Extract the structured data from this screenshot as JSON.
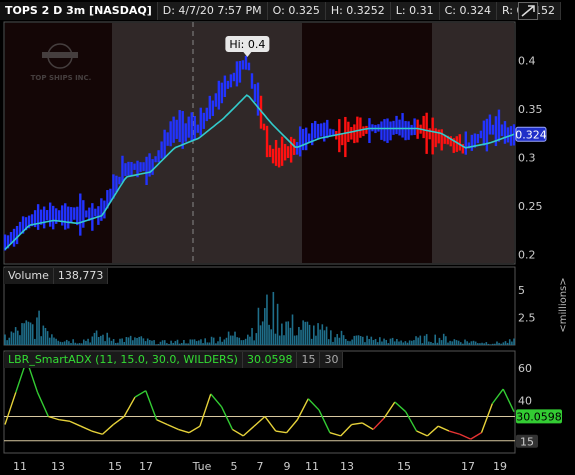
{
  "header": {
    "symbol": "TOPS 2 D 3m [NASDAQ]",
    "date": "D: 4/7/20 7:57 PM",
    "open": "O: 0.325",
    "high": "H: 0.3252",
    "low": "L: 0.31",
    "close": "C: 0.324",
    "range": "R: 0.0152"
  },
  "watermark": {
    "text": "TOP SHIPS INC."
  },
  "price_pane": {
    "hi_label": "Hi: 0.4",
    "last_price": "0.324",
    "y_ticks": [
      "0.4",
      "0.35",
      "0.3",
      "0.25",
      "0.2"
    ]
  },
  "volume_pane": {
    "label": "Volume",
    "value": "138,773",
    "y_ticks": [
      "5",
      "2.5"
    ],
    "unit": "<millions>"
  },
  "adx_pane": {
    "label": "LBR_SmartADX (11, 15.0, 30.0, WILDERS)",
    "value": "30.0598",
    "level1": "15",
    "level2": "30",
    "y_ticks": [
      "60",
      "40",
      "30",
      "15"
    ],
    "current": "30.0598",
    "level_badge": "15"
  },
  "x_axis": {
    "labels": [
      "11",
      "13",
      "15",
      "17",
      "Tue",
      "5",
      "7",
      "9",
      "11",
      "13",
      "15",
      "17",
      "19"
    ]
  },
  "colors": {
    "up": "#2233ff",
    "down": "#ff1111",
    "ma": "#33cccc",
    "volume": "#1f6f8b",
    "adx_green": "#33cc33",
    "adx_yellow": "#e6d23a",
    "adx_red": "#e63333",
    "session_dark": "#140606",
    "session_light": "#302828"
  },
  "chart_data": [
    {
      "type": "line",
      "name": "price",
      "ylim": [
        0.19,
        0.44
      ],
      "sessions": [
        "pre",
        "regular",
        "post",
        "regular",
        "post"
      ],
      "x": [
        "11",
        "13",
        "15",
        "17",
        "Tue",
        "5",
        "7",
        "9",
        "11",
        "13",
        "15",
        "17",
        "19"
      ],
      "close": [
        0.21,
        0.235,
        0.24,
        0.24,
        0.245,
        0.29,
        0.29,
        0.33,
        0.33,
        0.37,
        0.4,
        0.3,
        0.31,
        0.33,
        0.32,
        0.33,
        0.33,
        0.33,
        0.32,
        0.31,
        0.33,
        0.324
      ],
      "ma": [
        0.205,
        0.23,
        0.235,
        0.232,
        0.24,
        0.28,
        0.285,
        0.31,
        0.32,
        0.34,
        0.365,
        0.335,
        0.31,
        0.32,
        0.325,
        0.33,
        0.33,
        0.33,
        0.325,
        0.31,
        0.315,
        0.324
      ],
      "hi": 0.4,
      "last": 0.324
    },
    {
      "type": "bar",
      "name": "Volume",
      "ylim": [
        0,
        7
      ],
      "values": [
        1.2,
        2.5,
        3.3,
        0.9,
        0.6,
        1.5,
        0.8,
        1.0,
        0.4,
        0.5,
        0.6,
        0.9,
        1.4,
        2.0,
        5.5,
        3.1,
        2.6,
        1.8,
        1.4,
        1.0,
        0.8,
        0.6,
        0.9,
        1.2,
        0.7,
        0.5,
        0.3,
        0.6
      ]
    },
    {
      "type": "line",
      "name": "LBR_SmartADX",
      "ylim": [
        8,
        70
      ],
      "values": [
        25,
        45,
        65,
        45,
        30,
        28,
        27,
        24,
        21,
        19,
        25,
        30,
        42,
        46,
        28,
        25,
        22,
        20,
        24,
        44,
        36,
        22,
        18,
        24,
        30,
        21,
        20,
        28,
        41,
        34,
        20,
        18,
        25,
        26,
        22,
        29,
        39,
        33,
        21,
        18,
        24,
        21,
        19,
        16,
        20,
        38,
        47,
        33
      ],
      "colors": [
        "y",
        "g",
        "g",
        "g",
        "y",
        "y",
        "y",
        "y",
        "y",
        "y",
        "y",
        "y",
        "g",
        "g",
        "y",
        "y",
        "y",
        "y",
        "y",
        "g",
        "g",
        "y",
        "y",
        "y",
        "y",
        "y",
        "y",
        "y",
        "g",
        "g",
        "y",
        "y",
        "y",
        "y",
        "r",
        "y",
        "g",
        "g",
        "y",
        "y",
        "y",
        "r",
        "r",
        "r",
        "y",
        "g",
        "g",
        "g"
      ],
      "levels": [
        15,
        30
      ],
      "current": 30.0598
    }
  ]
}
